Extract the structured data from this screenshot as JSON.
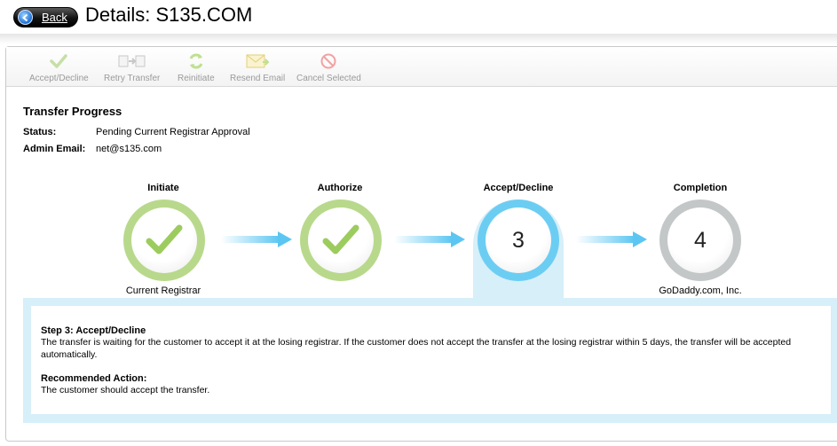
{
  "header": {
    "back_label": "Back",
    "title": "Details: S135.COM"
  },
  "toolbar": {
    "items": [
      {
        "label": "Accept/Decline",
        "icon": "checkmark-icon"
      },
      {
        "label": "Retry Transfer",
        "icon": "retry-transfer-icon"
      },
      {
        "label": "Reinitiate",
        "icon": "reinitiate-icon"
      },
      {
        "label": "Resend Email",
        "icon": "email-icon"
      },
      {
        "label": "Cancel Selected",
        "icon": "cancel-icon"
      }
    ]
  },
  "progress": {
    "title": "Transfer Progress",
    "status_label": "Status:",
    "status_value": "Pending Current Registrar Approval",
    "email_label": "Admin Email:",
    "email_value": "net@s135.com",
    "steps": [
      {
        "name": "Initiate",
        "state": "done",
        "number": "",
        "sub": "Current Registrar"
      },
      {
        "name": "Authorize",
        "state": "done",
        "number": "",
        "sub": ""
      },
      {
        "name": "Accept/Decline",
        "state": "active",
        "number": "3",
        "sub": ""
      },
      {
        "name": "Completion",
        "state": "todo",
        "number": "4",
        "sub": "GoDaddy.com, Inc."
      }
    ]
  },
  "detail": {
    "step_heading": "Step 3: Accept/Decline",
    "step_text": "The transfer is waiting for the customer to accept it at the losing registrar. If the customer does not accept the transfer at the losing registrar within 5 days, the transfer will be accepted automatically.",
    "action_heading": "Recommended Action:",
    "action_text": "The customer should accept the transfer."
  },
  "colors": {
    "done": "#b8d98b",
    "active": "#6ccdf3",
    "todo": "#c3c7c8",
    "arrow": "#5cc6f2",
    "panel_highlight": "#d6eff9"
  }
}
